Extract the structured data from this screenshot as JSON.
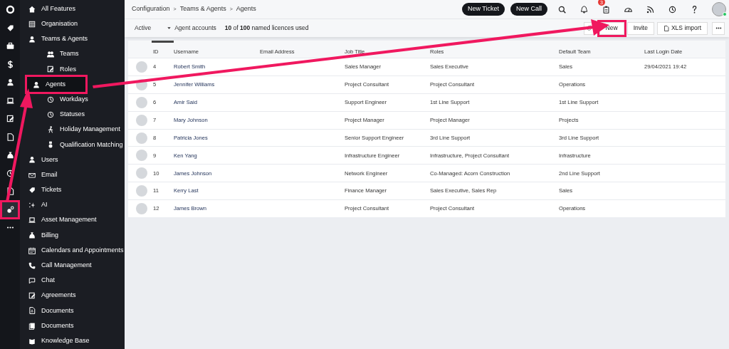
{
  "rail": {
    "items": [
      {
        "selected": false,
        "highlighted": false
      },
      {
        "selected": false,
        "highlighted": false
      },
      {
        "selected": false,
        "highlighted": false
      },
      {
        "selected": false,
        "highlighted": false
      },
      {
        "selected": false,
        "highlighted": false
      },
      {
        "selected": false,
        "highlighted": false
      },
      {
        "selected": false,
        "highlighted": false
      },
      {
        "selected": false,
        "highlighted": false
      },
      {
        "selected": false,
        "highlighted": false
      },
      {
        "selected": false,
        "highlighted": false
      },
      {
        "selected": false,
        "highlighted": false
      },
      {
        "selected": true,
        "highlighted": true
      },
      {
        "selected": false,
        "highlighted": false
      }
    ]
  },
  "sidebar": {
    "items": [
      {
        "label": "All Features",
        "selected": false,
        "highlighted": false
      },
      {
        "label": "Organisation",
        "selected": false,
        "highlighted": false
      },
      {
        "label": "Teams & Agents",
        "selected": false,
        "highlighted": false,
        "children": [
          {
            "label": "Teams",
            "selected": false,
            "highlighted": false
          },
          {
            "label": "Roles",
            "selected": false,
            "highlighted": false
          },
          {
            "label": "Agents",
            "selected": true,
            "highlighted": true
          },
          {
            "label": "Workdays",
            "selected": false,
            "highlighted": false
          },
          {
            "label": "Statuses",
            "selected": false,
            "highlighted": false
          },
          {
            "label": "Holiday Management",
            "selected": false,
            "highlighted": false
          },
          {
            "label": "Qualification Matching",
            "selected": false,
            "highlighted": false
          }
        ]
      },
      {
        "label": "Users",
        "selected": false,
        "highlighted": false
      },
      {
        "label": "Email",
        "selected": false,
        "highlighted": false
      },
      {
        "label": "Tickets",
        "selected": false,
        "highlighted": false
      },
      {
        "label": "AI",
        "selected": false,
        "highlighted": false
      },
      {
        "label": "Asset Management",
        "selected": false,
        "highlighted": false
      },
      {
        "label": "Billing",
        "selected": false,
        "highlighted": false
      },
      {
        "label": "Calendars and Appointments",
        "selected": false,
        "highlighted": false
      },
      {
        "label": "Call Management",
        "selected": false,
        "highlighted": false
      },
      {
        "label": "Chat",
        "selected": false,
        "highlighted": false
      },
      {
        "label": "Agreements",
        "selected": false,
        "highlighted": false
      },
      {
        "label": "Documents",
        "selected": false,
        "highlighted": false
      },
      {
        "label": "Documents",
        "selected": false,
        "highlighted": false
      },
      {
        "label": "Knowledge Base",
        "selected": false,
        "highlighted": false
      }
    ]
  },
  "breadcrumb": {
    "items": [
      "Configuration",
      "Teams & Agents",
      "Agents"
    ],
    "separator": ">"
  },
  "header_buttons": [
    "New Ticket",
    "New Call"
  ],
  "notification_badge": "3",
  "toolbar": {
    "filter": "Active",
    "view": "Agent accounts",
    "licences": "**10** of **100** named licences used",
    "buttons": [
      {
        "label": "New",
        "highlighted": true
      },
      {
        "label": "Invite",
        "highlighted": false
      },
      {
        "label": "XLS import",
        "highlighted": false
      }
    ]
  },
  "table": {
    "columns": [
      {
        "label": "ID",
        "sorted": true
      },
      {
        "label": "Username",
        "sorted": false
      },
      {
        "label": "Email Address",
        "sorted": false
      },
      {
        "label": "Job Title",
        "sorted": false
      },
      {
        "label": "Roles",
        "sorted": false
      },
      {
        "label": "Default Team",
        "sorted": false
      },
      {
        "label": "Last Login Date",
        "sorted": false
      }
    ],
    "rows": [
      {
        "id": "4",
        "username": "Robert Smith",
        "job_title": "Sales Manager",
        "roles": "Sales Executive",
        "default_team": "Sales",
        "last_login": "29/04/2021 19:42"
      },
      {
        "id": "5",
        "username": "Jennifer Williams",
        "job_title": "Project Consultant",
        "roles": "Project Consultant",
        "default_team": "Operations"
      },
      {
        "id": "6",
        "username": "Amir Said",
        "job_title": "Support Engineer",
        "roles": "1st Line Support",
        "default_team": "1st Line Support"
      },
      {
        "id": "7",
        "username": "Mary Johnson",
        "job_title": "Project Manager",
        "roles": "Project Manager",
        "default_team": "Projects"
      },
      {
        "id": "8",
        "username": "Patricia Jones",
        "job_title": "Senior Support Engineer",
        "roles": "3rd Line Support",
        "default_team": "3rd Line Support"
      },
      {
        "id": "9",
        "username": "Ken Yang",
        "job_title": "Infrastructure Engineer",
        "roles": "Infrastructure, Project Consultant",
        "default_team": "Infrastructure"
      },
      {
        "id": "10",
        "username": "James Johnson",
        "job_title": "Network Engineer",
        "roles": "Co-Managed: Acorn Construction",
        "default_team": "2nd Line Support"
      },
      {
        "id": "11",
        "username": "Kerry Last",
        "job_title": "Finance Manager",
        "roles": "Sales Executive, Sales Rep",
        "default_team": "Sales"
      },
      {
        "id": "12",
        "username": "James Brown",
        "job_title": "Project Consultant",
        "roles": "Project Consultant",
        "default_team": "Operations"
      }
    ]
  }
}
